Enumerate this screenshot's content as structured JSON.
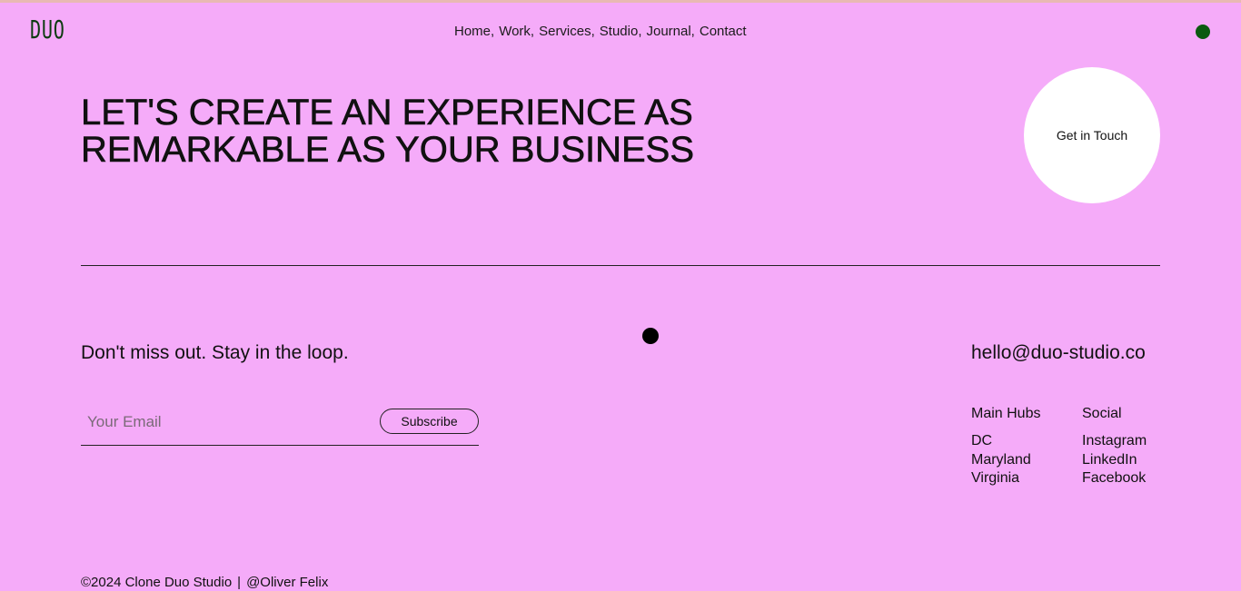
{
  "brand": {
    "logo": "DUO"
  },
  "nav": {
    "items": [
      "Home,",
      "Work,",
      "Services,",
      "Studio,",
      "Journal,",
      "Contact"
    ]
  },
  "hero": {
    "line1": "LET'S CREATE AN EXPERIENCE AS",
    "line2": "REMARKABLE AS YOUR BUSINESS",
    "cta_label": "Get in Touch"
  },
  "newsletter": {
    "title": "Don't miss out. Stay in the loop.",
    "email_placeholder": "Your Email",
    "email_value": "",
    "subscribe_label": "Subscribe"
  },
  "contact": {
    "email": "hello@duo-studio.co"
  },
  "hubs": {
    "heading": "Main Hubs",
    "items": [
      "DC",
      "Maryland",
      "Virginia"
    ]
  },
  "social": {
    "heading": "Social",
    "items": [
      "Instagram",
      "LinkedIn",
      "Facebook"
    ]
  },
  "footer": {
    "copyright": "©2024 Clone Duo Studio",
    "separator": "|",
    "credit": "@Oliver Felix"
  },
  "colors": {
    "background": "#f5abf9",
    "accent_dark_green": "#0b5a10",
    "text": "#111111",
    "cta_bg": "#ffffff"
  },
  "icons": [
    "status-dot-icon",
    "cursor-dot-icon"
  ]
}
